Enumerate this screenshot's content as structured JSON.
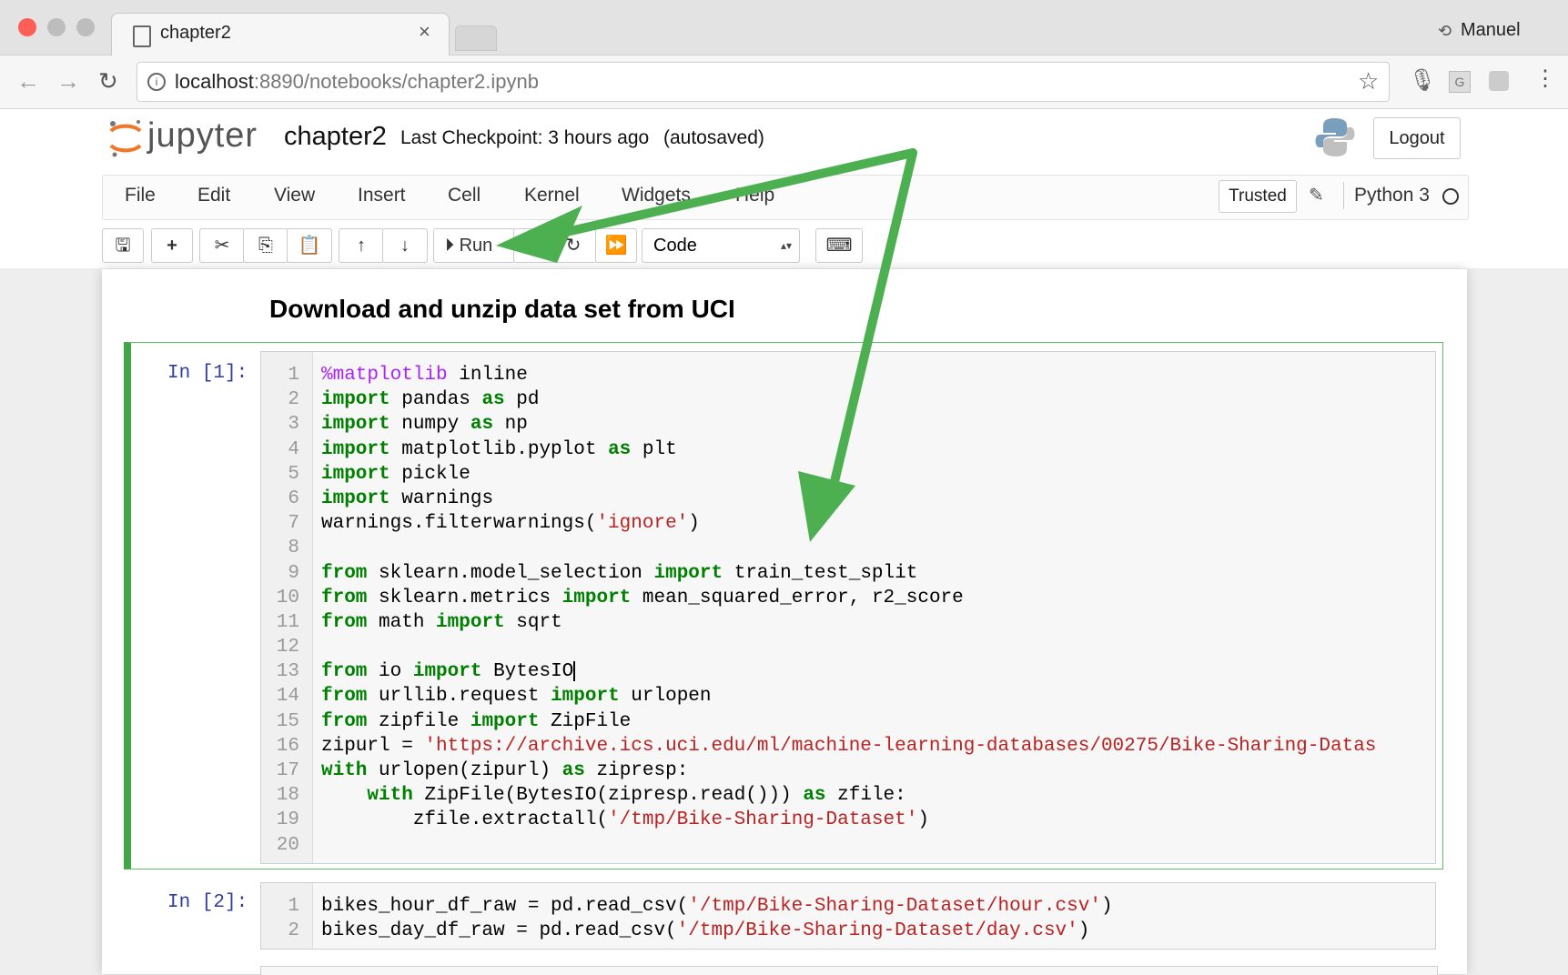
{
  "browser": {
    "tab_title": "chapter2",
    "tab_close": "×",
    "profile_name": "Manuel",
    "url_host": "localhost",
    "url_path": ":8890/notebooks/chapter2.ipynb"
  },
  "jupyter": {
    "logo_text": "jupyter",
    "notebook_name": "chapter2",
    "checkpoint": "Last Checkpoint: 3 hours ago",
    "autosaved": "(autosaved)",
    "logout_label": "Logout",
    "menu": [
      "File",
      "Edit",
      "View",
      "Insert",
      "Cell",
      "Kernel",
      "Widgets",
      "Help"
    ],
    "trusted_label": "Trusted",
    "kernel_name": "Python 3",
    "run_label": "Run",
    "cell_type": "Code"
  },
  "notebook": {
    "heading": "Download and unzip data set from UCI",
    "cell1": {
      "prompt": "In [1]:",
      "lines": [
        [
          [
            "m",
            "%matplotlib"
          ],
          [
            "t",
            " inline"
          ]
        ],
        [
          [
            "k",
            "import"
          ],
          [
            "t",
            " pandas "
          ],
          [
            "k",
            "as"
          ],
          [
            "t",
            " pd"
          ]
        ],
        [
          [
            "k",
            "import"
          ],
          [
            "t",
            " numpy "
          ],
          [
            "k",
            "as"
          ],
          [
            "t",
            " np"
          ]
        ],
        [
          [
            "k",
            "import"
          ],
          [
            "t",
            " matplotlib.pyplot "
          ],
          [
            "k",
            "as"
          ],
          [
            "t",
            " plt"
          ]
        ],
        [
          [
            "k",
            "import"
          ],
          [
            "t",
            " pickle"
          ]
        ],
        [
          [
            "k",
            "import"
          ],
          [
            "t",
            " warnings"
          ]
        ],
        [
          [
            "t",
            "warnings.filterwarnings("
          ],
          [
            "s",
            "'ignore'"
          ],
          [
            "t",
            ")"
          ]
        ],
        [],
        [
          [
            "k",
            "from"
          ],
          [
            "t",
            " sklearn.model_selection "
          ],
          [
            "k",
            "import"
          ],
          [
            "t",
            " train_test_split"
          ]
        ],
        [
          [
            "k",
            "from"
          ],
          [
            "t",
            " sklearn.metrics "
          ],
          [
            "k",
            "import"
          ],
          [
            "t",
            " mean_squared_error, r2_score"
          ]
        ],
        [
          [
            "k",
            "from"
          ],
          [
            "t",
            " math "
          ],
          [
            "k",
            "import"
          ],
          [
            "t",
            " sqrt"
          ]
        ],
        [],
        [
          [
            "k",
            "from"
          ],
          [
            "t",
            " io "
          ],
          [
            "k",
            "import"
          ],
          [
            "t",
            " BytesIO"
          ]
        ],
        [
          [
            "k",
            "from"
          ],
          [
            "t",
            " urllib.request "
          ],
          [
            "k",
            "import"
          ],
          [
            "t",
            " urlopen"
          ]
        ],
        [
          [
            "k",
            "from"
          ],
          [
            "t",
            " zipfile "
          ],
          [
            "k",
            "import"
          ],
          [
            "t",
            " ZipFile"
          ]
        ],
        [
          [
            "t",
            "zipurl = "
          ],
          [
            "s",
            "'https://archive.ics.uci.edu/ml/machine-learning-databases/00275/Bike-Sharing-Datas"
          ]
        ],
        [
          [
            "k",
            "with"
          ],
          [
            "t",
            " urlopen(zipurl) "
          ],
          [
            "k",
            "as"
          ],
          [
            "t",
            " zipresp:"
          ]
        ],
        [
          [
            "t",
            "    "
          ],
          [
            "k",
            "with"
          ],
          [
            "t",
            " ZipFile(BytesIO(zipresp.read())) "
          ],
          [
            "k",
            "as"
          ],
          [
            "t",
            " zfile:"
          ]
        ],
        [
          [
            "t",
            "        zfile.extractall("
          ],
          [
            "s",
            "'/tmp/Bike-Sharing-Dataset'"
          ],
          [
            "t",
            ")"
          ]
        ],
        []
      ]
    },
    "cell2": {
      "prompt": "In [2]:",
      "lines": [
        [
          [
            "t",
            "bikes_hour_df_raw = pd.read_csv("
          ],
          [
            "s",
            "'/tmp/Bike-Sharing-Dataset/hour.csv'"
          ],
          [
            "t",
            ")"
          ]
        ],
        [
          [
            "t",
            "bikes_day_df_raw = pd.read_csv("
          ],
          [
            "s",
            "'/tmp/Bike-Sharing-Dataset/day.csv'"
          ],
          [
            "t",
            ")"
          ]
        ]
      ]
    }
  },
  "colors": {
    "accent_green": "#4caf50",
    "cell_border": "#42a548"
  }
}
